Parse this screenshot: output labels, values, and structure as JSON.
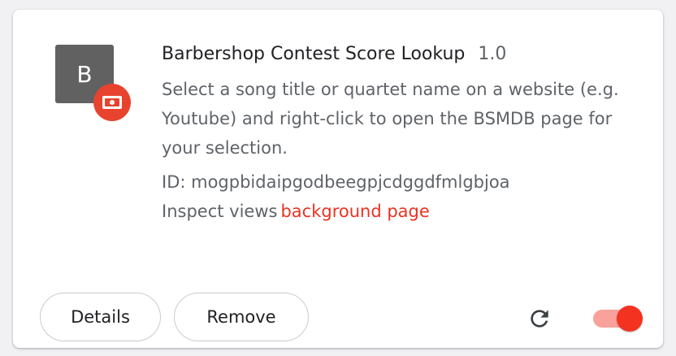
{
  "extension": {
    "icon_letter": "B",
    "name": "Barbershop Contest Score Lookup",
    "version": "1.0",
    "description": "Select a song title or quartet name on a website (e.g. Youtube) and right-click to open the BSMDB page for your selection.",
    "id_text": "ID: mogpbidaipgodbeegpjcdggdfmlgbjoa",
    "inspect_label": "Inspect views",
    "inspect_link": "background page",
    "enabled": true
  },
  "buttons": {
    "details": "Details",
    "remove": "Remove"
  },
  "icons": {
    "badge": "policy-badge-icon",
    "reload": "reload-icon"
  },
  "colors": {
    "accent": "#f43220",
    "link": "#ea3323",
    "badge": "#e8432e",
    "icon_bg": "#616161"
  }
}
